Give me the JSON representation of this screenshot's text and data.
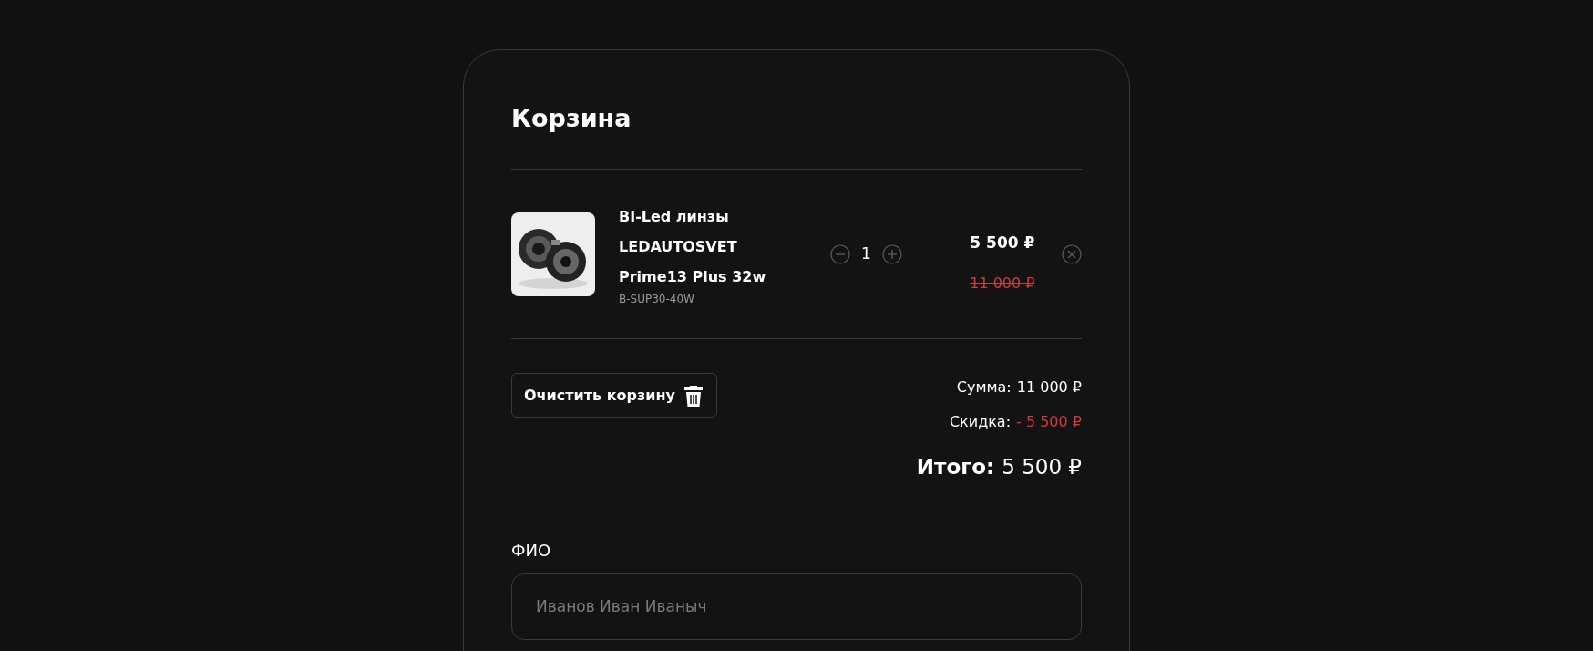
{
  "cart": {
    "title": "Корзина",
    "items": [
      {
        "name_lines": [
          "BI-Led линзы",
          "LEDAUTOSVET",
          "Prime13 Plus 32w"
        ],
        "sku": "B-SUP30-40W",
        "quantity": "1",
        "price": "5 500 ₽",
        "old_price": "11 000 ₽"
      }
    ],
    "clear_button": "Очистить корзину",
    "summary": {
      "sum_label": "Сумма:",
      "sum_value": "11 000 ₽",
      "discount_label": "Скидка:",
      "discount_value": "- 5 500 ₽",
      "total_label": "Итого:",
      "total_value": "5 500 ₽"
    },
    "form": {
      "fields": [
        {
          "label": "ФИО",
          "placeholder": "Иванов Иван Иваныч"
        }
      ]
    }
  }
}
